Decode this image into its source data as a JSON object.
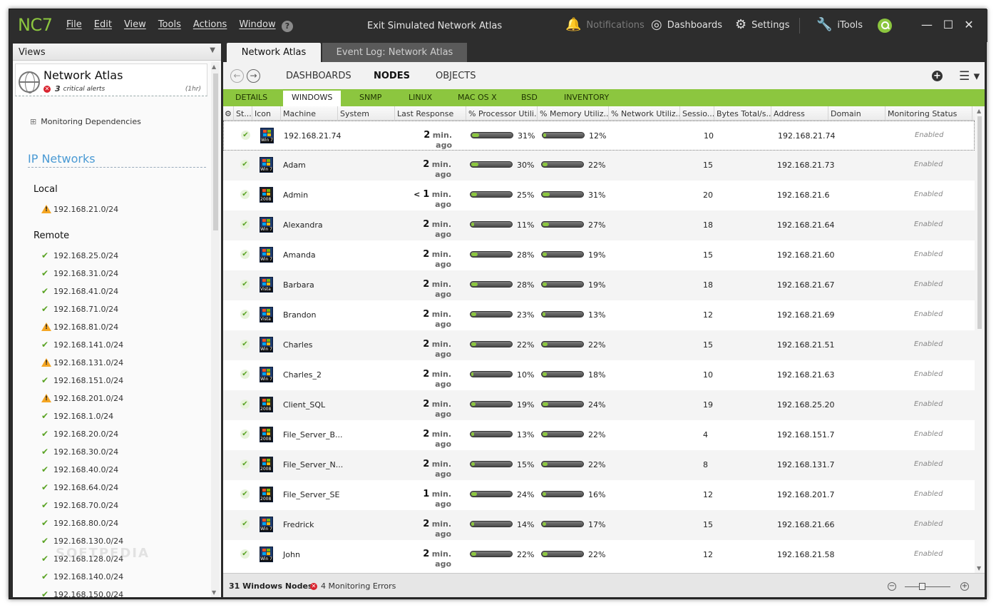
{
  "app": {
    "logo": "NC7",
    "menu": [
      "File",
      "Edit",
      "View",
      "Tools",
      "Actions",
      "Window"
    ],
    "help": "?",
    "center_title": "Exit Simulated Network Atlas",
    "notifications": "Notifications",
    "dashboards": "Dashboards",
    "settings": "Settings",
    "itools": "iTools",
    "min": "—",
    "max": "☐",
    "close": "✕"
  },
  "sidebar": {
    "header": "Views",
    "atlas_title": "Network Atlas",
    "critical_count": "3",
    "critical_label": "critical alerts",
    "critical_time": "(1hr)",
    "dependencies": "Monitoring Dependencies",
    "ip_networks": "IP Networks",
    "local_label": "Local",
    "local": [
      {
        "name": "192.168.21.0/24",
        "status": "warn"
      }
    ],
    "remote_label": "Remote",
    "remote": [
      {
        "name": "192.168.25.0/24",
        "status": "ok"
      },
      {
        "name": "192.168.31.0/24",
        "status": "ok"
      },
      {
        "name": "192.168.41.0/24",
        "status": "ok"
      },
      {
        "name": "192.168.71.0/24",
        "status": "ok"
      },
      {
        "name": "192.168.81.0/24",
        "status": "warn"
      },
      {
        "name": "192.168.141.0/24",
        "status": "ok"
      },
      {
        "name": "192.168.131.0/24",
        "status": "warn"
      },
      {
        "name": "192.168.151.0/24",
        "status": "ok"
      },
      {
        "name": "192.168.201.0/24",
        "status": "warn"
      },
      {
        "name": "192.168.1.0/24",
        "status": "ok"
      },
      {
        "name": "192.168.20.0/24",
        "status": "ok"
      },
      {
        "name": "192.168.30.0/24",
        "status": "ok"
      },
      {
        "name": "192.168.40.0/24",
        "status": "ok"
      },
      {
        "name": "192.168.64.0/24",
        "status": "ok"
      },
      {
        "name": "192.168.70.0/24",
        "status": "ok"
      },
      {
        "name": "192.168.80.0/24",
        "status": "ok"
      },
      {
        "name": "192.168.130.0/24",
        "status": "ok"
      },
      {
        "name": "192.168.128.0/24",
        "status": "ok"
      },
      {
        "name": "192.168.140.0/24",
        "status": "ok"
      },
      {
        "name": "192.168.150.0/24",
        "status": "ok"
      }
    ]
  },
  "tabs": {
    "active": "Network Atlas",
    "inactive": "Event Log: Network Atlas"
  },
  "nav": {
    "dashboards": "DASHBOARDS",
    "nodes": "NODES",
    "objects": "OBJECTS",
    "plus": "+",
    "menu": "☰ ▾"
  },
  "subtabs": [
    "DETAILS",
    "WINDOWS",
    "SNMP",
    "LINUX",
    "MAC OS X",
    "BSD",
    "INVENTORY"
  ],
  "columns": [
    "St...",
    "Icon",
    "Machine",
    "System",
    "Last Response",
    "% Processor Utili...",
    "% Memory Utiliz...",
    "% Network Utiliz...",
    "Sessio...",
    "Bytes Total/s...",
    "Address",
    "Domain",
    "Monitoring Status"
  ],
  "rows": [
    {
      "machine": "192.168.21.74",
      "os": "Win 7",
      "resp_prefix": "",
      "resp_num": "2",
      "resp_unit": "min. ago",
      "cpu": 31,
      "cpu_label": "31%",
      "mem": 12,
      "mem_label": "12%",
      "sessions": "10",
      "address": "192.168.21.74",
      "status": "Enabled"
    },
    {
      "machine": "Adam",
      "os": "Win 7",
      "resp_prefix": "",
      "resp_num": "2",
      "resp_unit": "min. ago",
      "cpu": 30,
      "cpu_label": "30%",
      "mem": 22,
      "mem_label": "22%",
      "sessions": "15",
      "address": "192.168.21.73",
      "status": "Enabled"
    },
    {
      "machine": "Admin",
      "os": "2008",
      "resp_prefix": "< ",
      "resp_num": "1",
      "resp_unit": "min. ago",
      "cpu": 25,
      "cpu_label": "25%",
      "mem": 31,
      "mem_label": "31%",
      "sessions": "20",
      "address": "192.168.21.6",
      "status": "Enabled"
    },
    {
      "machine": "Alexandra",
      "os": "Win 7",
      "resp_prefix": "",
      "resp_num": "2",
      "resp_unit": "min. ago",
      "cpu": 11,
      "cpu_label": "11%",
      "mem": 27,
      "mem_label": "27%",
      "sessions": "18",
      "address": "192.168.21.64",
      "status": "Enabled"
    },
    {
      "machine": "Amanda",
      "os": "Win 7",
      "resp_prefix": "",
      "resp_num": "2",
      "resp_unit": "min. ago",
      "cpu": 28,
      "cpu_label": "28%",
      "mem": 19,
      "mem_label": "19%",
      "sessions": "15",
      "address": "192.168.21.60",
      "status": "Enabled"
    },
    {
      "machine": "Barbara",
      "os": "Vista",
      "resp_prefix": "",
      "resp_num": "2",
      "resp_unit": "min. ago",
      "cpu": 28,
      "cpu_label": "28%",
      "mem": 19,
      "mem_label": "19%",
      "sessions": "18",
      "address": "192.168.21.67",
      "status": "Enabled"
    },
    {
      "machine": "Brandon",
      "os": "Vista",
      "resp_prefix": "",
      "resp_num": "2",
      "resp_unit": "min. ago",
      "cpu": 23,
      "cpu_label": "23%",
      "mem": 13,
      "mem_label": "13%",
      "sessions": "12",
      "address": "192.168.21.69",
      "status": "Enabled"
    },
    {
      "machine": "Charles",
      "os": "Win 7",
      "resp_prefix": "",
      "resp_num": "2",
      "resp_unit": "min. ago",
      "cpu": 22,
      "cpu_label": "22%",
      "mem": 22,
      "mem_label": "22%",
      "sessions": "15",
      "address": "192.168.21.51",
      "status": "Enabled"
    },
    {
      "machine": "Charles_2",
      "os": "Win 7",
      "resp_prefix": "",
      "resp_num": "2",
      "resp_unit": "min. ago",
      "cpu": 10,
      "cpu_label": "10%",
      "mem": 18,
      "mem_label": "18%",
      "sessions": "10",
      "address": "192.168.21.63",
      "status": "Enabled"
    },
    {
      "machine": "Client_SQL",
      "os": "2008",
      "resp_prefix": "",
      "resp_num": "2",
      "resp_unit": "min. ago",
      "cpu": 19,
      "cpu_label": "19%",
      "mem": 24,
      "mem_label": "24%",
      "sessions": "19",
      "address": "192.168.25.20",
      "status": "Enabled"
    },
    {
      "machine": "File_Server_B...",
      "os": "2008",
      "resp_prefix": "",
      "resp_num": "2",
      "resp_unit": "min. ago",
      "cpu": 13,
      "cpu_label": "13%",
      "mem": 22,
      "mem_label": "22%",
      "sessions": "4",
      "address": "192.168.151.7",
      "status": "Enabled"
    },
    {
      "machine": "File_Server_N...",
      "os": "2008",
      "resp_prefix": "",
      "resp_num": "2",
      "resp_unit": "min. ago",
      "cpu": 15,
      "cpu_label": "15%",
      "mem": 22,
      "mem_label": "22%",
      "sessions": "8",
      "address": "192.168.131.7",
      "status": "Enabled"
    },
    {
      "machine": "File_Server_SE",
      "os": "2008",
      "resp_prefix": "",
      "resp_num": "1",
      "resp_unit": "min. ago",
      "cpu": 24,
      "cpu_label": "24%",
      "mem": 16,
      "mem_label": "16%",
      "sessions": "12",
      "address": "192.168.201.7",
      "status": "Enabled"
    },
    {
      "machine": "Fredrick",
      "os": "Win 7",
      "resp_prefix": "",
      "resp_num": "2",
      "resp_unit": "min. ago",
      "cpu": 14,
      "cpu_label": "14%",
      "mem": 17,
      "mem_label": "17%",
      "sessions": "15",
      "address": "192.168.21.66",
      "status": "Enabled"
    },
    {
      "machine": "John",
      "os": "Win 7",
      "resp_prefix": "",
      "resp_num": "2",
      "resp_unit": "min. ago",
      "cpu": 22,
      "cpu_label": "22%",
      "mem": 22,
      "mem_label": "22%",
      "sessions": "12",
      "address": "192.168.21.58",
      "status": "Enabled"
    }
  ],
  "statusbar": {
    "count": "31 Windows Nodes",
    "errors": "4 Monitoring Errors",
    "zoom_minus": "−",
    "zoom_plus": "+"
  },
  "colors": {
    "accent": "#8cc63f",
    "titlebar": "#2d2d2d",
    "link": "#4a9ad4",
    "error": "#d9232e",
    "warning": "#f5a623"
  }
}
